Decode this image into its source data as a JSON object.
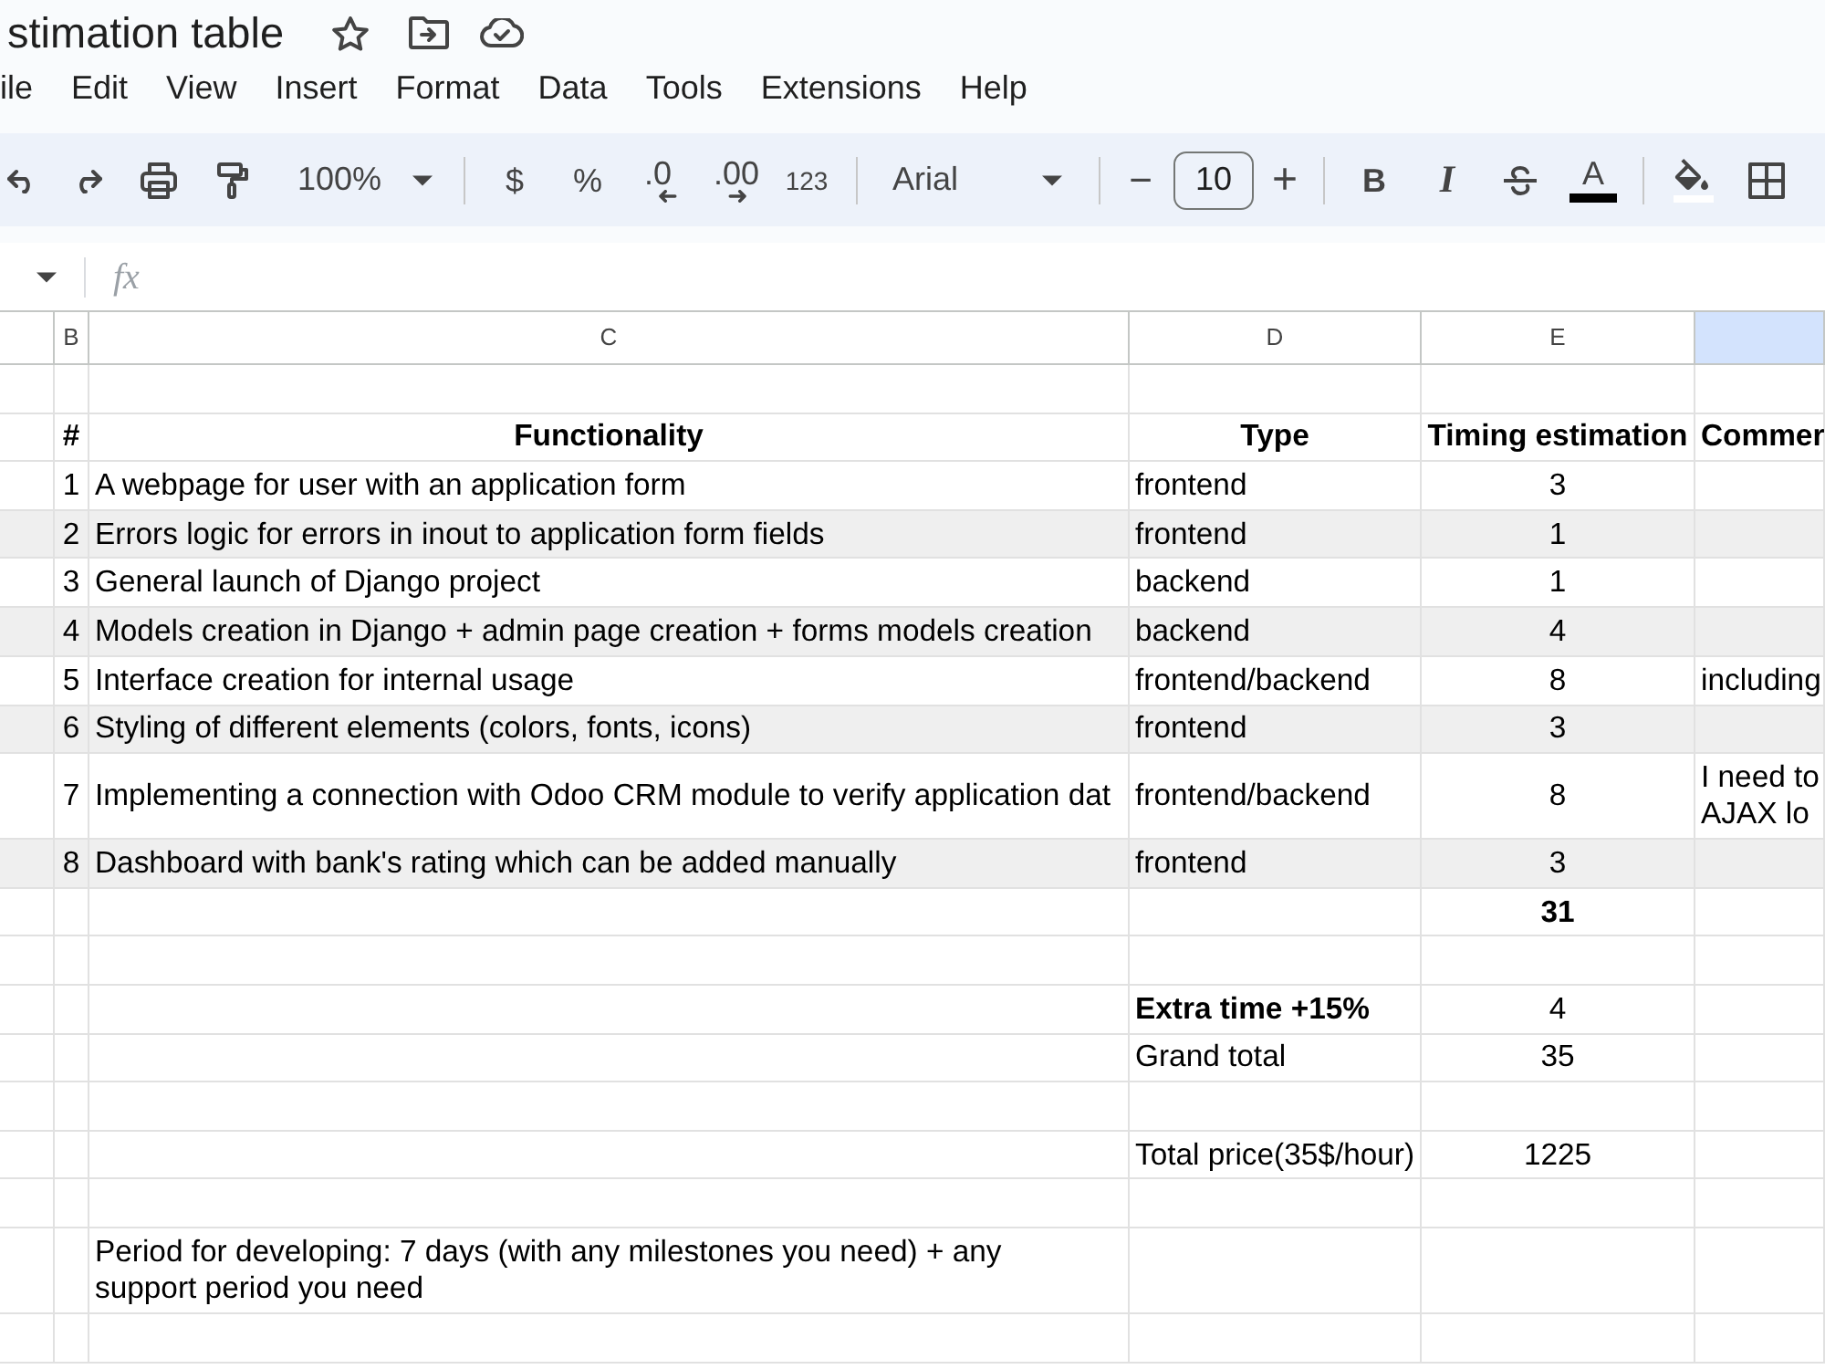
{
  "document": {
    "title": "stimation table"
  },
  "menu": [
    "ile",
    "Edit",
    "View",
    "Insert",
    "Format",
    "Data",
    "Tools",
    "Extensions",
    "Help"
  ],
  "toolbar": {
    "zoom": "100%",
    "currency": "$",
    "percent": "%",
    "decrease_decimals": ".0",
    "increase_decimals": ".00",
    "number_format": "123",
    "font": "Arial",
    "size_down": "−",
    "font_size": "10",
    "size_up": "+",
    "bold": "B",
    "italic": "I",
    "text_color": "A"
  },
  "formula_bar": {
    "label": "fx"
  },
  "columns": [
    {
      "selected": false
    },
    {
      "label": "B",
      "selected": false
    },
    {
      "label": "C",
      "selected": false
    },
    {
      "label": "D",
      "selected": false
    },
    {
      "label": "E",
      "selected": false
    },
    {
      "selected": true
    }
  ],
  "rows": [
    {
      "kind": "blank"
    },
    {
      "kind": "header",
      "cells": [
        "#",
        "Functionality",
        "Type",
        "Timing estimation",
        "Commer"
      ]
    },
    {
      "kind": "task",
      "shaded": false,
      "cells": [
        "1",
        "A webpage for user with an application form",
        "frontend",
        "3"
      ]
    },
    {
      "kind": "task",
      "shaded": true,
      "cells": [
        "2",
        "Errors logic for errors in inout to application form fields",
        "frontend",
        "1"
      ]
    },
    {
      "kind": "task",
      "shaded": false,
      "cells": [
        "3",
        "General launch of Django project",
        "backend",
        "1"
      ]
    },
    {
      "kind": "task",
      "shaded": true,
      "cells": [
        "4",
        "Models creation in Django + admin page creation + forms models creation",
        "backend",
        "4"
      ]
    },
    {
      "kind": "task",
      "shaded": false,
      "cells": [
        "5",
        "Interface creation for internal usage",
        "frontend/backend",
        "8",
        "including"
      ]
    },
    {
      "kind": "task",
      "shaded": true,
      "cells": [
        "6",
        "Styling of different elements (colors, fonts, icons)",
        "frontend",
        "3"
      ]
    },
    {
      "kind": "task",
      "shaded": false,
      "cells": [
        "7",
        "Implementing a connection with Odoo CRM module to verify application dat",
        "frontend/backend",
        "8",
        "I need to\nAJAX lo"
      ]
    },
    {
      "kind": "task",
      "shaded": true,
      "cells": [
        "8",
        "Dashboard with bank's rating which can be added manually",
        "frontend",
        "3"
      ]
    },
    {
      "kind": "total",
      "value": "31"
    },
    {
      "kind": "blank"
    },
    {
      "kind": "extra",
      "label": "Extra time +15%",
      "value": "4"
    },
    {
      "kind": "summary",
      "label": "Grand total",
      "value": "35"
    },
    {
      "kind": "blank"
    },
    {
      "kind": "summary",
      "label": "Total price(35$/hour)",
      "value": "1225"
    },
    {
      "kind": "blank"
    },
    {
      "kind": "note",
      "text": "Period for developing: 7 days (with any milestones you need) + any support period you need"
    },
    {
      "kind": "blank"
    }
  ]
}
